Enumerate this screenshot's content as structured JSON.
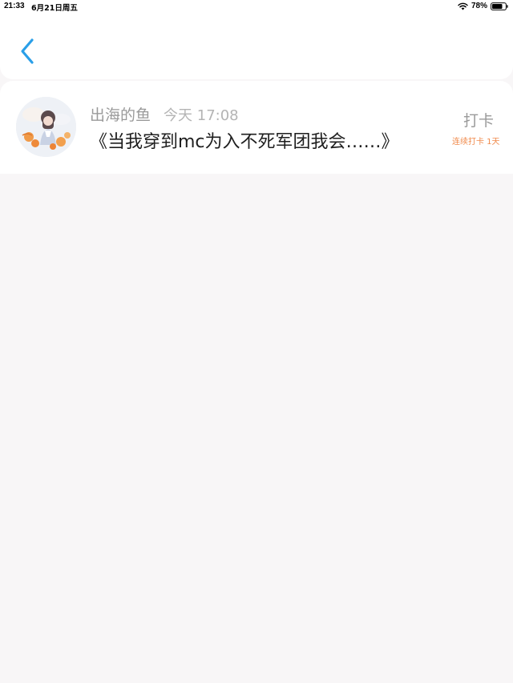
{
  "status_bar": {
    "time": "21:33",
    "date": "6月21日周五",
    "battery": "78%",
    "icons": [
      "wifi-icon",
      "battery-icon"
    ]
  },
  "header": {
    "back_icon": "chevron-left-icon"
  },
  "post": {
    "username": "出海的鱼",
    "timestamp": "今天 17:08",
    "title": "《当我穿到mc为入不死军团我会……》",
    "checkin_label": "打卡",
    "streak_label": "连续打卡 1天"
  },
  "colors": {
    "accent_blue": "#2a9fe8",
    "streak_orange": "#f08a4b",
    "background": "#f8f6f7"
  }
}
